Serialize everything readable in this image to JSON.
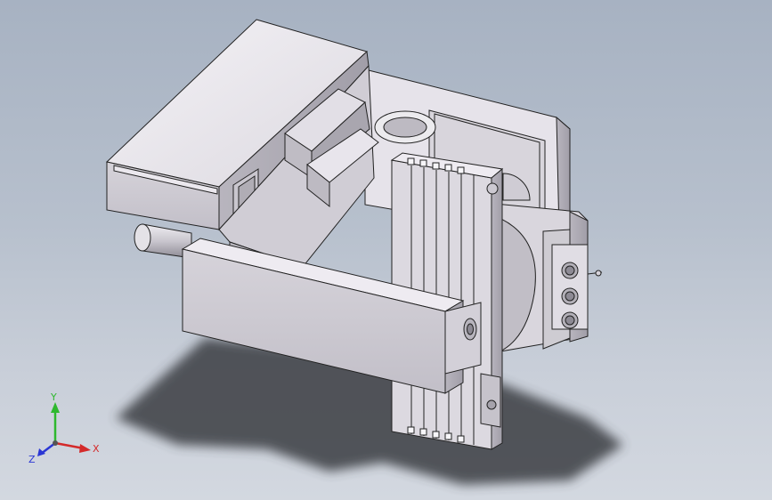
{
  "viewport": {
    "model": "3d-cad-assembly-isometric",
    "background_top": "#a7b2c2",
    "background_bottom": "#d3d8e0",
    "shadow_color": "#3b3d42"
  },
  "triad": {
    "x_label": "X",
    "y_label": "Y",
    "z_label": "Z",
    "x_color": "#d42a2a",
    "y_color": "#2eb82e",
    "z_color": "#2a36d4"
  }
}
